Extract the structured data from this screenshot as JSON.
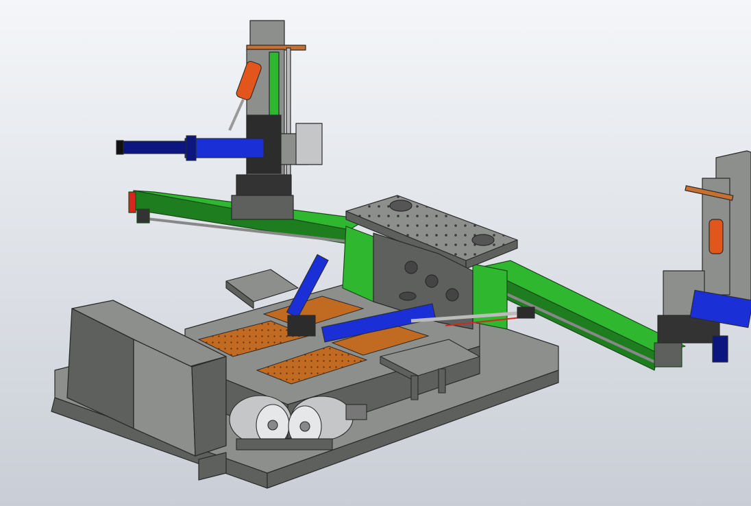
{
  "viewport": {
    "background_top": "#f4f6f9",
    "background_bottom": "#c9ced6"
  },
  "colors": {
    "frame_green": "#2fb82f",
    "frame_green_dark": "#1e7d1e",
    "steel_gray": "#8d8f8c",
    "steel_gray_dark": "#5d605d",
    "cylinder_blue": "#1b2fd6",
    "cylinder_blue_dark": "#0b1680",
    "actuator_orange": "#e2561c",
    "plate_copper": "#c06a22",
    "stop_red": "#d8261f",
    "edge_dark": "#2a2a2a",
    "motor_silver": "#c4c6c8"
  },
  "components": {
    "left_column": "vertical-column-left",
    "right_column": "vertical-column-right",
    "green_rail_upper": "green-guide-rail-upper",
    "green_rail_lower": "green-guide-rail-lower",
    "turntable": "perforated-turntable",
    "base": "machine-base",
    "cabinet": "control-cabinet",
    "motors": "drive-motors",
    "center_cylinders": "center-hydraulic-cylinders"
  }
}
